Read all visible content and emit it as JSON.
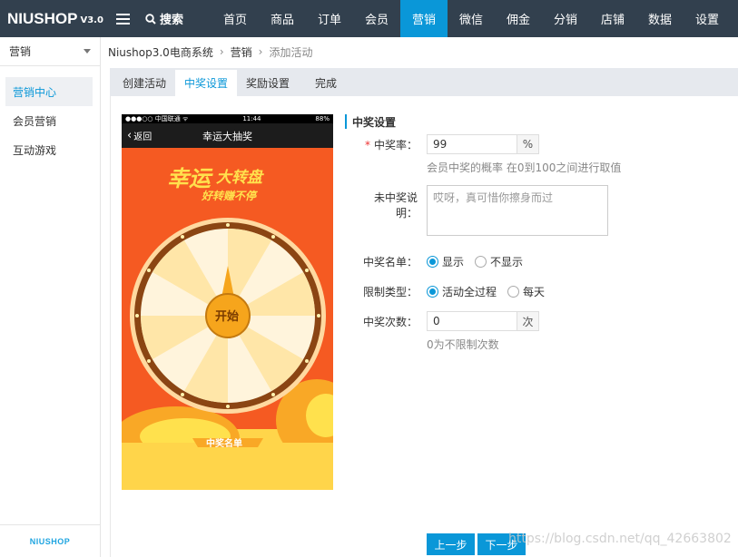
{
  "topbar": {
    "logo_text": "NIUSHOP",
    "logo_version": "V3.0",
    "search_label": "搜索",
    "nav": [
      "首页",
      "商品",
      "订单",
      "会员",
      "营销",
      "微信",
      "佣金",
      "分销",
      "店铺",
      "数据",
      "设置"
    ],
    "active_nav": "营销"
  },
  "sidebar": {
    "select_label": "营销",
    "items": [
      {
        "label": "营销中心",
        "active": true
      },
      {
        "label": "会员营销",
        "active": false
      },
      {
        "label": "互动游戏",
        "active": false
      }
    ],
    "footer_logo": "NIUSHOP"
  },
  "breadcrumb": [
    "Niushop3.0电商系统",
    "营销",
    "添加活动"
  ],
  "tabs": [
    {
      "label": "创建活动",
      "active": false
    },
    {
      "label": "中奖设置",
      "active": true
    },
    {
      "label": "奖励设置",
      "active": false
    },
    {
      "label": "完成",
      "active": false
    }
  ],
  "phone": {
    "status_left": "●●●○○ 中国联通 ᯤ",
    "status_time": "11:44",
    "status_right": "88%",
    "back_label": "返回",
    "title": "幸运大抽奖",
    "banner_line1": "幸运大转盘",
    "banner_line2": "好转赚不停",
    "start_button": "开始",
    "winners_label": "中奖名单"
  },
  "form": {
    "section_title": "中奖设置",
    "win_rate": {
      "label": "中奖率：",
      "value": "99",
      "unit": "%",
      "help": "会员中奖的概率 在0到100之间进行取值"
    },
    "lose_text": {
      "label": "未中奖说明：",
      "placeholder": "哎呀，真可惜你擦身而过"
    },
    "winner_list": {
      "label": "中奖名单：",
      "options": [
        "显示",
        "不显示"
      ],
      "selected": "显示"
    },
    "limit_type": {
      "label": "限制类型：",
      "options": [
        "活动全过程",
        "每天"
      ],
      "selected": "活动全过程"
    },
    "win_count": {
      "label": "中奖次数：",
      "value": "0",
      "unit": "次",
      "help": "0为不限制次数"
    }
  },
  "buttons": {
    "prev": "上一步",
    "next": "下一步"
  },
  "watermark": "https://blog.csdn.net/qq_42663802",
  "colors": {
    "accent": "#0a97d8",
    "topbar": "#32404e"
  }
}
